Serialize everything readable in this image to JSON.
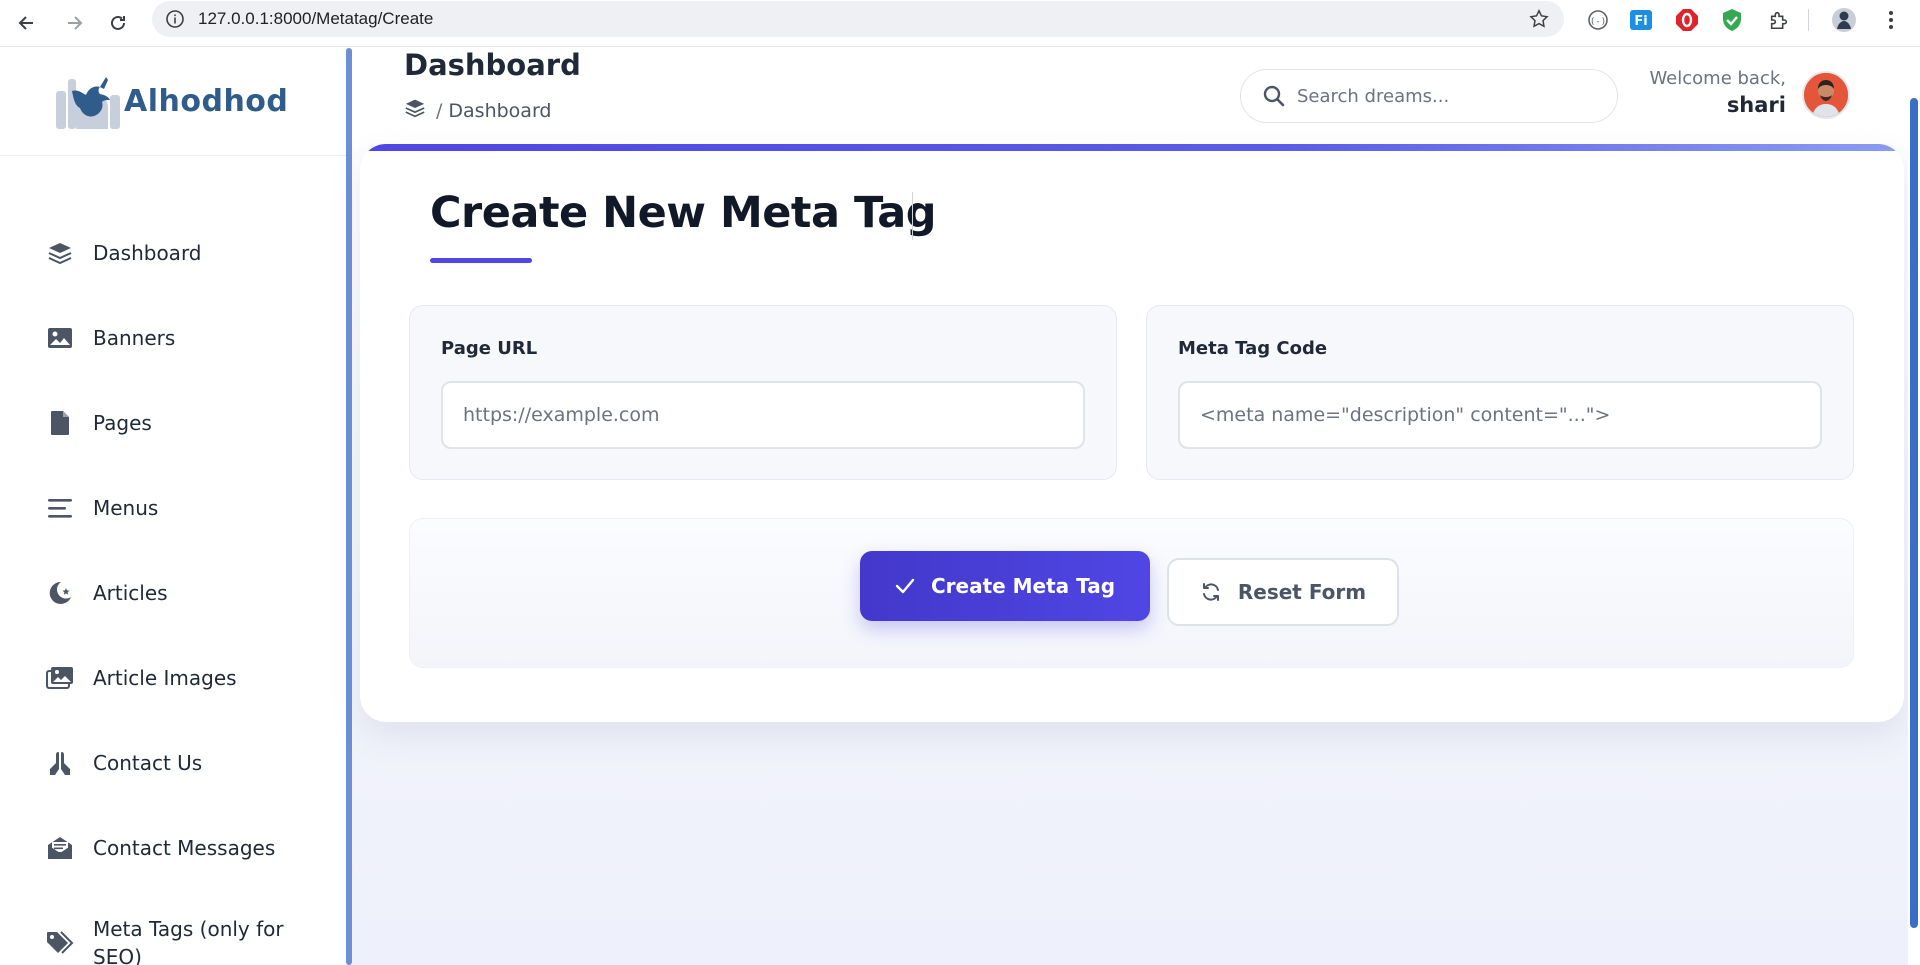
{
  "browser": {
    "url": "127.0.0.1:8000/Metatag/Create",
    "icons": [
      "back-arrow-icon",
      "forward-arrow-icon",
      "reload-icon",
      "info-icon",
      "star-icon",
      "extension-icons",
      "menu-dots-icon"
    ]
  },
  "brand": {
    "name": "Alhodhod"
  },
  "sidebar": {
    "items": [
      {
        "label": "Dashboard",
        "icon": "layers-icon"
      },
      {
        "label": "Banners",
        "icon": "image-icon"
      },
      {
        "label": "Pages",
        "icon": "file-icon"
      },
      {
        "label": "Menus",
        "icon": "menu-lines-icon"
      },
      {
        "label": "Articles",
        "icon": "crescent-star-icon"
      },
      {
        "label": "Article Images",
        "icon": "images-icon"
      },
      {
        "label": "Contact Us",
        "icon": "praying-hands-icon"
      },
      {
        "label": "Contact Messages",
        "icon": "envelope-open-icon"
      },
      {
        "label": "Meta Tags (only for SEO)",
        "icon": "tags-icon"
      }
    ]
  },
  "header": {
    "title": "Dashboard",
    "breadcrumb": {
      "separator": "/",
      "current": "Dashboard"
    },
    "search": {
      "placeholder": "Search dreams..."
    },
    "welcome": {
      "greeting": "Welcome back,",
      "user": "shari"
    }
  },
  "form": {
    "heading": "Create New Meta Tag",
    "fields": [
      {
        "label": "Page URL",
        "placeholder": "https://example.com",
        "value": ""
      },
      {
        "label": "Meta Tag Code",
        "placeholder": "<meta name=\"description\" content=\"...\">",
        "value": ""
      }
    ],
    "submit_label": "Create Meta Tag",
    "reset_label": "Reset Form"
  },
  "colors": {
    "accent": "#4f46e5",
    "brand": "#2f5c8a",
    "sidebar_rail": "#6c8fd8"
  }
}
